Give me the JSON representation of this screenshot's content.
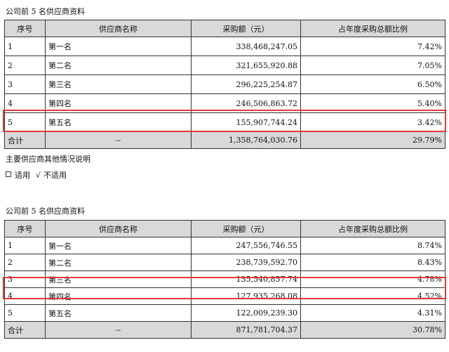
{
  "table1": {
    "title": "公司前 5 名供应商资料",
    "headers": [
      "序号",
      "供应商名称",
      "采购额（元）",
      "占年度采购总额比例"
    ],
    "rows": [
      {
        "idx": "1",
        "name": "第一名",
        "amount": "338,468,247.05",
        "pct": "7.42%"
      },
      {
        "idx": "2",
        "name": "第二名",
        "amount": "321,655,920.88",
        "pct": "7.05%"
      },
      {
        "idx": "3",
        "name": "第三名",
        "amount": "296,225,254.87",
        "pct": "6.50%"
      },
      {
        "idx": "4",
        "name": "第四名",
        "amount": "246,506,863.72",
        "pct": "5.40%"
      },
      {
        "idx": "5",
        "name": "第五名",
        "amount": "155,907,744.24",
        "pct": "3.42%"
      }
    ],
    "total": {
      "label": "合计",
      "name": "--",
      "amount": "1,358,764,030.76",
      "pct": "29.79%"
    }
  },
  "note": {
    "text": "主要供应商其他情况说明",
    "opt_applicable": "适用",
    "check_mark": "√",
    "opt_not_applicable": "不适用"
  },
  "table2": {
    "title": "公司前 5 名供应商资料",
    "headers": [
      "序号",
      "供应商名称",
      "采购额（元）",
      "占年度采购总额比例"
    ],
    "rows": [
      {
        "idx": "1",
        "name": "第一名",
        "amount": "247,556,746.55",
        "pct": "8.74%"
      },
      {
        "idx": "2",
        "name": "第二名",
        "amount": "238,739,592.70",
        "pct": "8.43%"
      },
      {
        "idx": "3",
        "name": "第三名",
        "amount": "135,540,857.74",
        "pct": "4.78%"
      },
      {
        "idx": "4",
        "name": "第四名",
        "amount": "127,935,268.08",
        "pct": "4.52%"
      },
      {
        "idx": "5",
        "name": "第五名",
        "amount": "122,009,239.30",
        "pct": "4.31%"
      }
    ],
    "total": {
      "label": "合计",
      "name": "--",
      "amount": "871,781,704.37",
      "pct": "30.78%"
    }
  },
  "colors": {
    "highlight": "#e03a3a",
    "header_bg": "#d9d9d9"
  }
}
